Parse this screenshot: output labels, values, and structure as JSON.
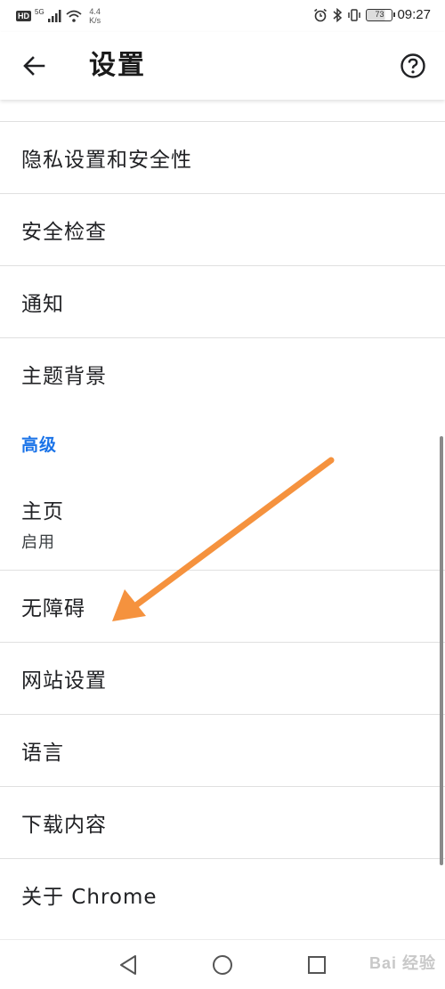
{
  "status_bar": {
    "hd": "HD",
    "network": "5G",
    "speed_value": "4.4",
    "speed_unit": "K/s",
    "battery": "73",
    "time": "09:27"
  },
  "toolbar": {
    "title": "设置"
  },
  "settings": {
    "items_top": [
      {
        "label": "隐私设置和安全性"
      },
      {
        "label": "安全检查"
      },
      {
        "label": "通知"
      },
      {
        "label": "主题背景"
      }
    ],
    "advanced_header": "高级",
    "homepage": {
      "label": "主页",
      "sub": "启用"
    },
    "items_bottom": [
      {
        "label": "无障碍"
      },
      {
        "label": "网站设置"
      },
      {
        "label": "语言"
      },
      {
        "label": "下载内容"
      },
      {
        "label": "关于 Chrome"
      }
    ]
  },
  "colors": {
    "accent": "#1a73e8",
    "annotation_arrow": "#f5923e"
  },
  "watermark": "Bai 经验",
  "icons": [
    "back-arrow-icon",
    "help-circle-icon",
    "nav-back-icon",
    "nav-home-icon",
    "nav-recents-icon"
  ]
}
